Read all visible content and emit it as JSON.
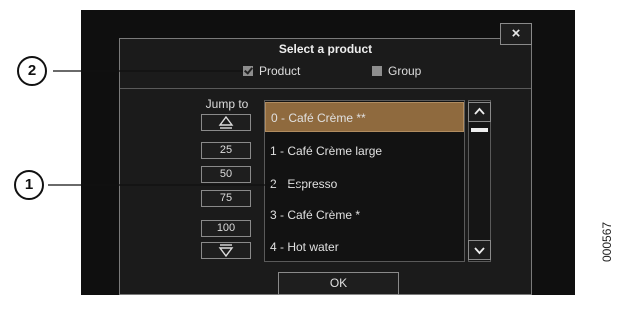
{
  "dialog": {
    "title": "Select a product",
    "close_label": "×",
    "filters": [
      {
        "label": "Product",
        "checked": true
      },
      {
        "label": "Group",
        "checked": false
      }
    ],
    "jump_to_label": "Jump to",
    "jump_buttons": [
      "",
      "25",
      "50",
      "75",
      "100",
      ""
    ],
    "products": [
      {
        "label": "0 - Café Crème **",
        "selected": true
      },
      {
        "label": "1 - Café Crème large",
        "selected": false
      },
      {
        "label": "2 - Espresso",
        "selected": false
      },
      {
        "label": "3 - Café Crème *",
        "selected": false
      },
      {
        "label": "4 - Hot water",
        "selected": false
      }
    ],
    "ok_label": "OK"
  },
  "annotations": {
    "callout_1": "1",
    "callout_2": "2",
    "figure_id": "000567"
  },
  "colors": {
    "selected_item": "#8f6a3e",
    "background": "#1b1b1b"
  }
}
